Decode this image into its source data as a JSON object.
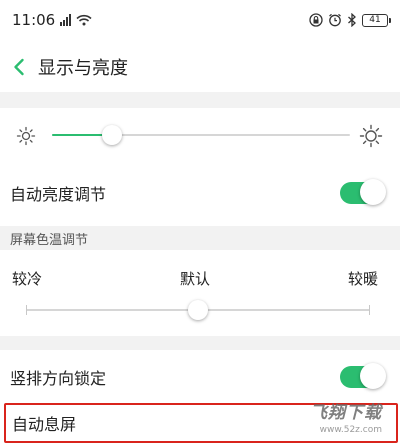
{
  "status_bar": {
    "time": "11:06",
    "battery": "41",
    "icons": [
      "signal-icon",
      "wifi-icon",
      "lock-icon",
      "alarm-icon",
      "bluetooth-icon",
      "battery-icon"
    ]
  },
  "header": {
    "back_icon": "chevron-left-icon",
    "title": "显示与亮度"
  },
  "brightness": {
    "level": 0.2,
    "icons": [
      "sun-small-icon",
      "sun-large-icon"
    ]
  },
  "auto_brightness": {
    "label": "自动亮度调节",
    "enabled": true
  },
  "color_temp": {
    "section_label": "屏幕色温调节",
    "left_label": "较冷",
    "center_label": "默认",
    "right_label": "较暖",
    "level": 0.5
  },
  "orientation_lock": {
    "label": "竖排方向锁定",
    "enabled": true
  },
  "auto_screen_off": {
    "label": "自动息屏"
  },
  "watermark": {
    "brand": "飞翔下载",
    "url": "www.52z.com"
  },
  "colors": {
    "accent": "#2bbd70",
    "highlight": "#d9241c",
    "divider": "#f2f2f2"
  }
}
